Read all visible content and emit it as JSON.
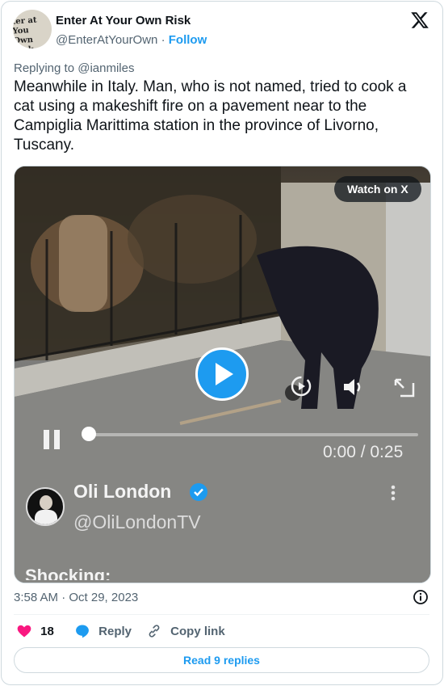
{
  "author": {
    "name": "Enter At Your Own Risk",
    "handle": "@EnterAtYourOwn",
    "separator": "·",
    "follow_label": "Follow",
    "avatar_text_line1": "ter at You",
    "avatar_text_line2": "Own Risk"
  },
  "reply_context": {
    "prefix": "Replying to ",
    "user": "@ianmiles"
  },
  "tweet_text": "Meanwhile in Italy.  Man, who is not named, tried to cook a cat using a makeshift fire on a pavement near to the Campiglia Marittima station in the province of Livorno, Tuscany.",
  "media": {
    "watch_label": "Watch on X",
    "time_display": "0:00 / 0:25",
    "overlay_name": "Oli London",
    "overlay_handle": "@OliLondonTV",
    "overlay_caption": "Shocking:",
    "progress_fraction": 0.0
  },
  "timestamp": "3:58 AM · Oct 29, 2023",
  "actions": {
    "likes_count": "18",
    "reply_label": "Reply",
    "copy_label": "Copy link"
  },
  "read_replies_label": "Read 9 replies",
  "colors": {
    "accent": "#1d9bf0",
    "like": "#f91880",
    "muted": "#536471",
    "text": "#0f1419"
  }
}
